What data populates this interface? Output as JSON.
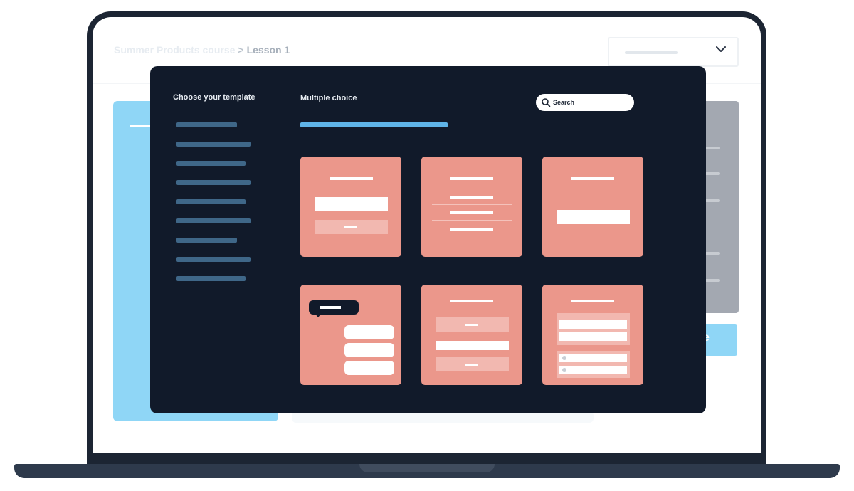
{
  "background_app": {
    "breadcrumb": {
      "course": "Summer Products course",
      "separator": ">",
      "lesson": "Lesson 1"
    },
    "button_partial_text": "e"
  },
  "modal": {
    "sidebar_title": "Choose your template",
    "sidebar_items": [
      {
        "active": false
      },
      {
        "active": false
      },
      {
        "active": false
      },
      {
        "active": true
      },
      {
        "active": false
      },
      {
        "active": false
      },
      {
        "active": false
      },
      {
        "active": false
      },
      {
        "active": false
      }
    ],
    "section_title": "Multiple choice",
    "search": {
      "placeholder": "Search",
      "value": ""
    },
    "templates_count": 6
  },
  "colors": {
    "modal_bg": "#111a2a",
    "template_card": "#eb978b",
    "accent_blue": "#5fb4e8",
    "sidebar_item": "#3f6788",
    "laptop_frame": "#1c2533"
  },
  "icons": [
    "chevron-down-icon",
    "search-icon"
  ]
}
